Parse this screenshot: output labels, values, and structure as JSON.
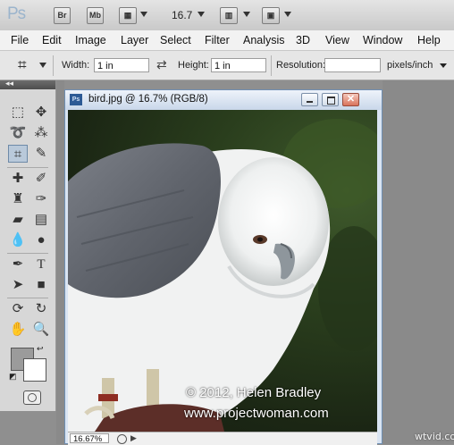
{
  "appbar": {
    "logo": "Ps",
    "bridge_label": "Br",
    "minibridge_label": "Mb",
    "zoom": "16.7"
  },
  "menu": [
    "File",
    "Edit",
    "Image",
    "Layer",
    "Select",
    "Filter",
    "Analysis",
    "3D",
    "View",
    "Window",
    "Help"
  ],
  "options": {
    "width_label": "Width:",
    "width_value": "1 in",
    "height_label": "Height:",
    "height_value": "1 in",
    "resolution_label": "Resolution:",
    "resolution_value": "",
    "units": "pixels/inch"
  },
  "document": {
    "title": "bird.jpg @ 16.7% (RGB/8)",
    "icon_label": "Ps",
    "zoom_status": "16.67%",
    "copyright": "© 2012, Helen Bradley",
    "website": "www.projectwoman.com"
  },
  "colors": {
    "foreground": "#9b9b9b",
    "background": "#ffffff"
  },
  "watermark": "wtvid.com"
}
